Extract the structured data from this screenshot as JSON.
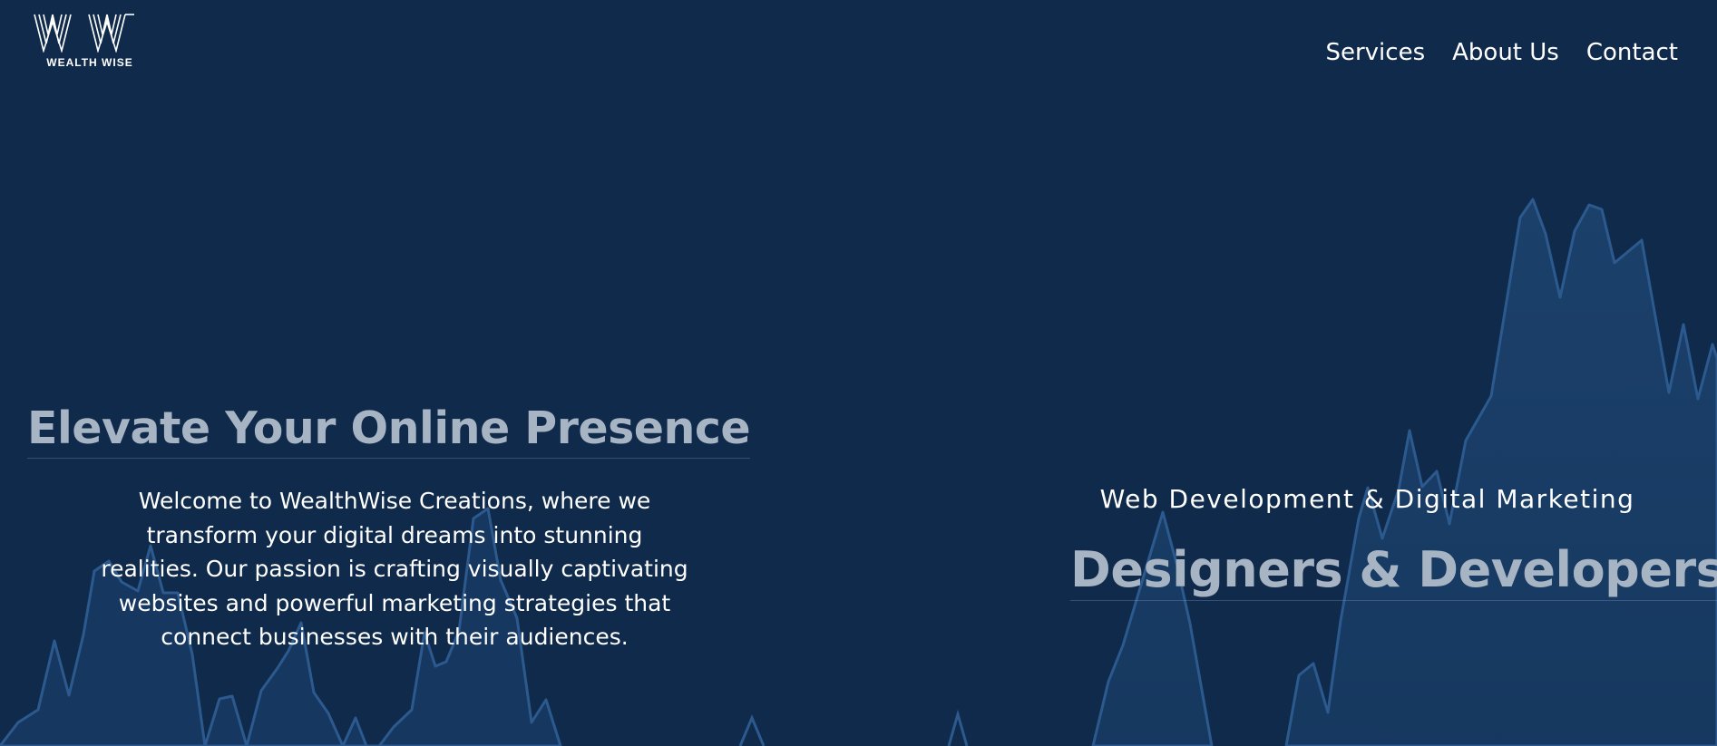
{
  "brand": {
    "name": "WEALTH WISE",
    "logo_icon": "double-w-logo"
  },
  "nav": {
    "items": [
      {
        "label": "Services"
      },
      {
        "label": "About Us"
      },
      {
        "label": "Contact"
      }
    ]
  },
  "hero": {
    "title": "Elevate Your Online Presence",
    "description": "Welcome to WealthWise Creations, where we transform your digital dreams into stunning realities. Our passion is crafting visually captivating websites and powerful marketing strategies that connect businesses with their audiences.",
    "subtitle": "Web Development & Digital Marketing",
    "tagline": "Designers & Developers"
  },
  "colors": {
    "background": "#0f2a4a",
    "chart_fill": "#1c426d",
    "chart_line": "#2c5a8e",
    "heading_muted": "#a7b4c4",
    "text": "#ffffff"
  }
}
